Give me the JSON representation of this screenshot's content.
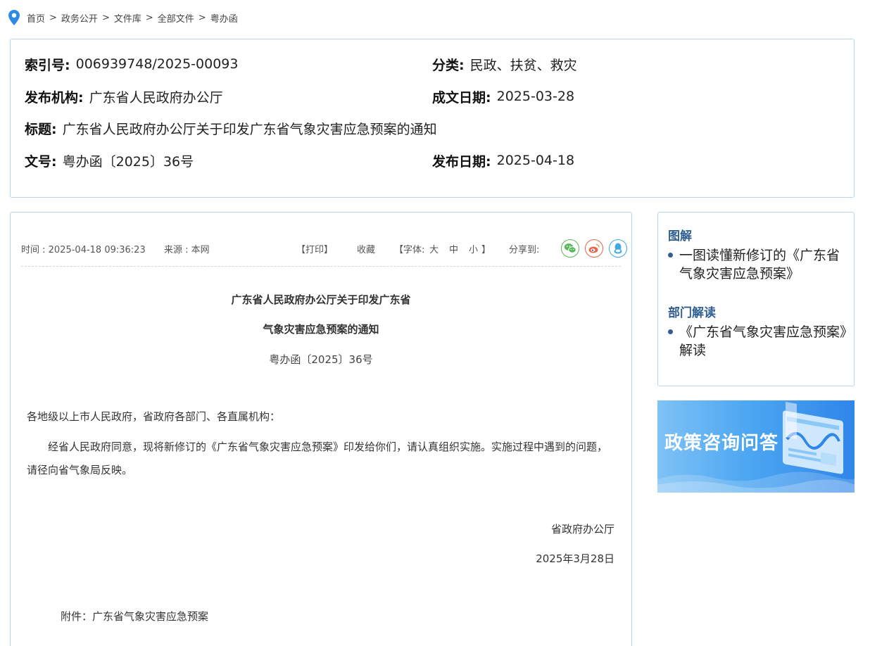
{
  "breadcrumb": [
    "首页",
    "政务公开",
    "文件库",
    "全部文件",
    "粤办函"
  ],
  "meta": {
    "index_label": "索引号:",
    "index_value": "006939748/2025-00093",
    "category_label": "分类:",
    "category_value": "民政、扶贫、救灾",
    "publisher_label": "发布机构:",
    "publisher_value": "广东省人民政府办公厅",
    "written_date_label": "成文日期:",
    "written_date_value": "2025-03-28",
    "title_label": "标题:",
    "title_value": "广东省人民政府办公厅关于印发广东省气象灾害应急预案的通知",
    "docnum_label": "文号:",
    "docnum_value": "粤办函〔2025〕36号",
    "publish_date_label": "发布日期:",
    "publish_date_value": "2025-04-18"
  },
  "toolbar": {
    "time": "时间 : 2025-04-18 09:36:23",
    "source": "来源 : 本网",
    "print": "【打印】",
    "favorite": "收藏",
    "font_prefix": "【字体:",
    "font_large": "大",
    "font_medium": "中",
    "font_small": "小",
    "font_suffix": "】",
    "share_label": "分享到:",
    "share_icons": [
      "wechat-icon",
      "weibo-icon",
      "qq-icon"
    ]
  },
  "article": {
    "title_line1": "广东省人民政府办公厅关于印发广东省",
    "title_line2": "气象灾害应急预案的通知",
    "doc_number": "粤办函〔2025〕36号",
    "salutation": "各地级以上市人民政府，省政府各部门、各直属机构：",
    "body": "经省人民政府同意，现将新修订的《广东省气象灾害应急预案》印发给你们，请认真组织实施。实施过程中遇到的问题，请径向省气象局反映。",
    "signature": "省政府办公厅",
    "sign_date": "2025年3月28日",
    "attachment": "附件：广东省气象灾害应急预案"
  },
  "sidebar": {
    "section1_title": "图解",
    "section1_item": "一图读懂新修订的《广东省气象灾害应急预案》",
    "section2_title": "部门解读",
    "section2_item": "《广东省气象灾害应急预案》解读"
  },
  "banner": {
    "text": "政策咨询问答"
  },
  "colors": {
    "border": "#b9d5ea",
    "heading_blue": "#2f5f90",
    "wechat": "#5cb85c",
    "weibo": "#e8664a",
    "qq": "#3fa9e0",
    "pin": "#2b8be6"
  }
}
